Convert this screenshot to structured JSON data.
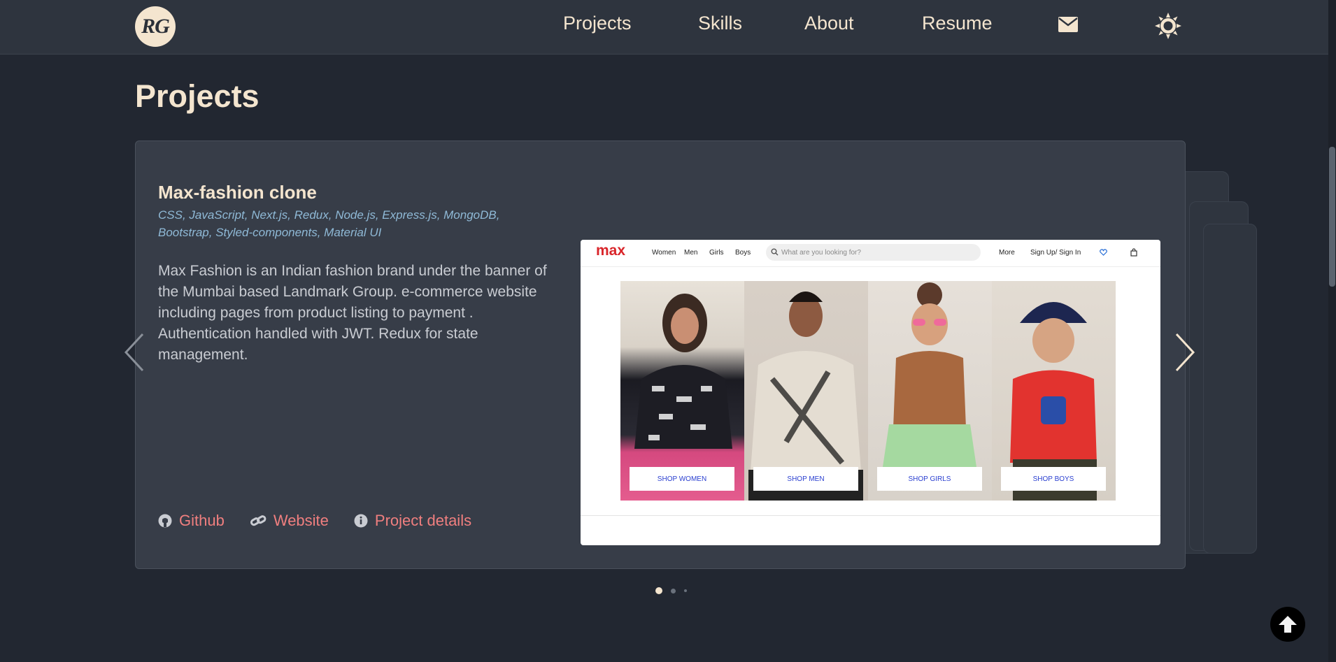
{
  "nav": {
    "logo_text": "RG",
    "links": [
      "Projects",
      "Skills",
      "About",
      "Resume"
    ],
    "mail_icon": "envelope-icon",
    "theme_icon": "sun-icon"
  },
  "page": {
    "title": "Projects"
  },
  "project": {
    "title": "Max-fashion clone",
    "tech": "CSS, JavaScript, Next.js, Redux, Node.js, Express.js, MongoDB, Bootstrap, Styled-components, Material UI",
    "description": "Max Fashion is an Indian fashion brand under the banner of the Mumbai based Landmark Group. e-commerce website including pages from product listing to payment . Authentication handled with JWT. Redux for state management.",
    "links": {
      "github": "Github",
      "website": "Website",
      "details": "Project details"
    },
    "screenshot": {
      "brand": "max",
      "nav": [
        "Women",
        "Men",
        "Girls",
        "Boys"
      ],
      "search_placeholder": "What are you looking for?",
      "more": "More",
      "signin": "Sign Up/ Sign In",
      "buttons": [
        "SHOP WOMEN",
        "SHOP MEN",
        "SHOP GIRLS",
        "SHOP BOYS"
      ]
    }
  },
  "carousel": {
    "active_slide": 1,
    "slide_count": 3
  },
  "colors": {
    "background": "#222731",
    "card": "#373d48",
    "accent_link": "#f07f7f",
    "tech": "#8fb9d6",
    "cream": "#f4e5cf"
  }
}
